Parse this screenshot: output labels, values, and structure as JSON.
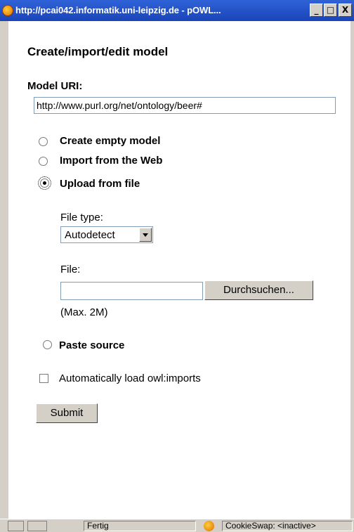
{
  "window": {
    "title": "http://pcai042.informatik.uni-leipzig.de - pOWL...",
    "minimize": "_",
    "maximize": "□",
    "close": "X"
  },
  "form": {
    "heading": "Create/import/edit model",
    "uri_label": "Model URI:",
    "uri_value": "http://www.purl.org/net/ontology/beer#",
    "options": [
      {
        "label": "Create empty model",
        "checked": false
      },
      {
        "label": "Import from the Web",
        "checked": false
      },
      {
        "label": "Upload from file",
        "checked": true
      },
      {
        "label": "Paste source",
        "checked": false
      }
    ],
    "file_type_label": "File type:",
    "file_type_value": "Autodetect",
    "file_label": "File:",
    "file_value": "",
    "browse_label": "Durchsuchen...",
    "max_size": "(Max. 2M)",
    "autoload_label": "Automatically load owl:imports",
    "autoload_checked": false,
    "submit_label": "Submit"
  },
  "statusbar": {
    "status": "Fertig",
    "cookieswap": "CookieSwap: <inactive>"
  },
  "colors": {
    "titlebar": "#2f62d8",
    "chrome": "#d4d0c8"
  }
}
